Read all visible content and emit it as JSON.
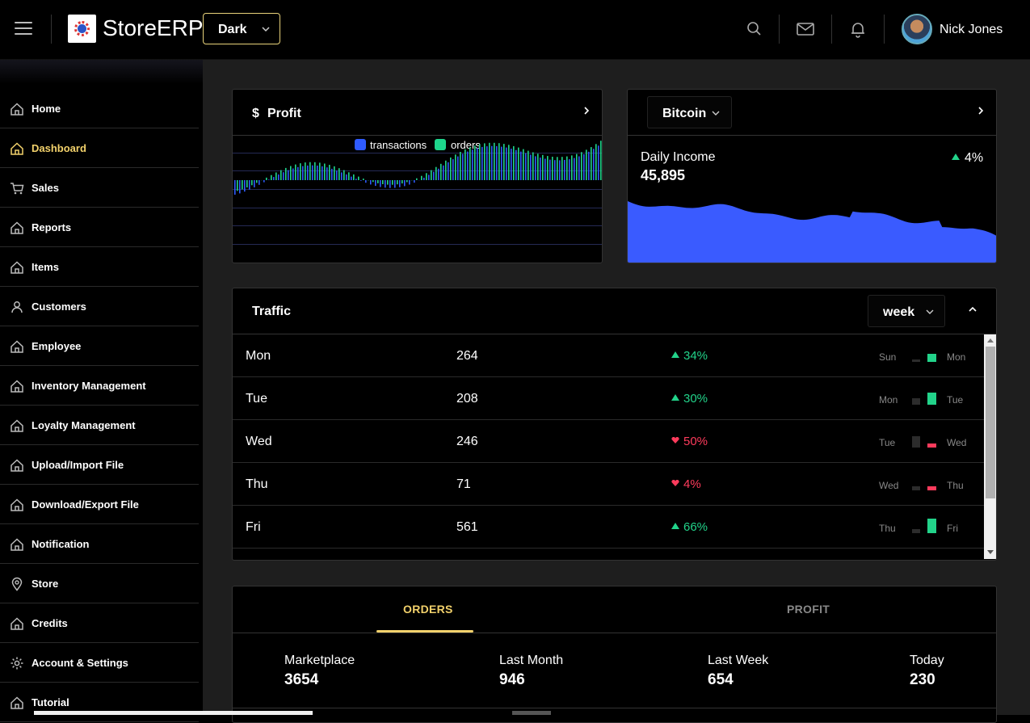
{
  "header": {
    "brand": "StoreERP",
    "theme_value": "Dark",
    "username": "Nick Jones"
  },
  "sidebar": {
    "items": [
      {
        "label": "Home",
        "icon": "home-icon"
      },
      {
        "label": "Dashboard",
        "icon": "home-icon",
        "active": true
      },
      {
        "label": "Sales",
        "icon": "cart-icon"
      },
      {
        "label": "Reports",
        "icon": "home-icon"
      },
      {
        "label": "Items",
        "icon": "home-icon"
      },
      {
        "label": "Customers",
        "icon": "user-icon"
      },
      {
        "label": "Employee",
        "icon": "home-icon"
      },
      {
        "label": "Inventory Management",
        "icon": "home-icon"
      },
      {
        "label": "Loyalty Management",
        "icon": "home-icon"
      },
      {
        "label": "Upload/Import File",
        "icon": "home-icon"
      },
      {
        "label": "Download/Export File",
        "icon": "home-icon"
      },
      {
        "label": "Notification",
        "icon": "home-icon"
      },
      {
        "label": "Store",
        "icon": "location-pin-icon"
      },
      {
        "label": "Credits",
        "icon": "home-icon"
      },
      {
        "label": "Account & Settings",
        "icon": "gear-icon"
      },
      {
        "label": "Tutorial",
        "icon": "home-icon"
      }
    ]
  },
  "profit_card": {
    "currency_symbol": "$",
    "title": "Profit",
    "legend": [
      "transactions",
      "orders"
    ]
  },
  "bitcoin_card": {
    "selected": "Bitcoin",
    "label": "Daily Income",
    "value": "45,895",
    "change": "4%"
  },
  "traffic": {
    "title": "Traffic",
    "period": "week",
    "rows": [
      {
        "day": "Mon",
        "count": "264",
        "change": "34%",
        "dir": "up",
        "prev": "Sun",
        "cur": "Mon",
        "prev_level": 0.15,
        "cur_level": 0.55
      },
      {
        "day": "Tue",
        "count": "208",
        "change": "30%",
        "dir": "up",
        "prev": "Mon",
        "cur": "Tue",
        "prev_level": 0.5,
        "cur_level": 0.85
      },
      {
        "day": "Wed",
        "count": "246",
        "change": "50%",
        "dir": "down",
        "prev": "Tue",
        "cur": "Wed",
        "prev_level": 0.85,
        "cur_level": 0.3
      },
      {
        "day": "Thu",
        "count": "71",
        "change": "4%",
        "dir": "down",
        "prev": "Wed",
        "cur": "Thu",
        "prev_level": 0.3,
        "cur_level": 0.3
      },
      {
        "day": "Fri",
        "count": "561",
        "change": "66%",
        "dir": "up",
        "prev": "Thu",
        "cur": "Fri",
        "prev_level": 0.3,
        "cur_level": 1.0
      }
    ]
  },
  "orders_card": {
    "tabs": [
      "ORDERS",
      "PROFIT"
    ],
    "stats": [
      {
        "label": "Marketplace",
        "value": "3654"
      },
      {
        "label": "Last Month",
        "value": "946"
      },
      {
        "label": "Last Week",
        "value": "654"
      },
      {
        "label": "Today",
        "value": "230"
      }
    ]
  },
  "colors": {
    "accent": "#f2d16b",
    "up": "#22d38a",
    "down": "#ff3b5c",
    "transactions": "#2f5bff",
    "orders": "#1ed68c",
    "income_fill": "#3a5bff"
  }
}
